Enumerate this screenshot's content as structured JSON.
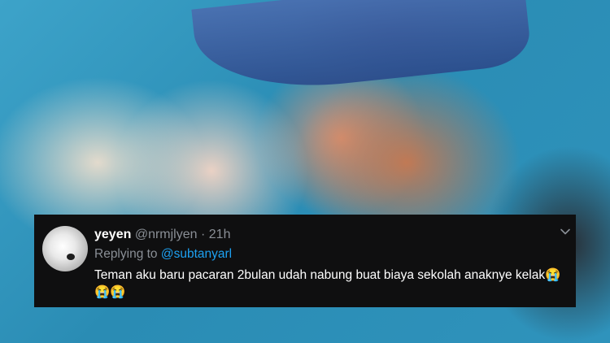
{
  "tweet": {
    "display_name": "yeyen",
    "handle": "@nrmjlyen",
    "separator": "·",
    "time": "21h",
    "replying_prefix": "Replying to ",
    "replying_handle": "@subtanyarl",
    "text": "Teman aku baru pacaran 2bulan udah nabung buat biaya sekolah anaknye kelak😭😭😭"
  },
  "icons": {
    "more": "chevron-down-icon",
    "avatar": "avatar"
  },
  "colors": {
    "card_background": "#0f0f10",
    "secondary_text": "#8a8f96",
    "link": "#1da1f2",
    "primary_text": "#ffffff"
  }
}
